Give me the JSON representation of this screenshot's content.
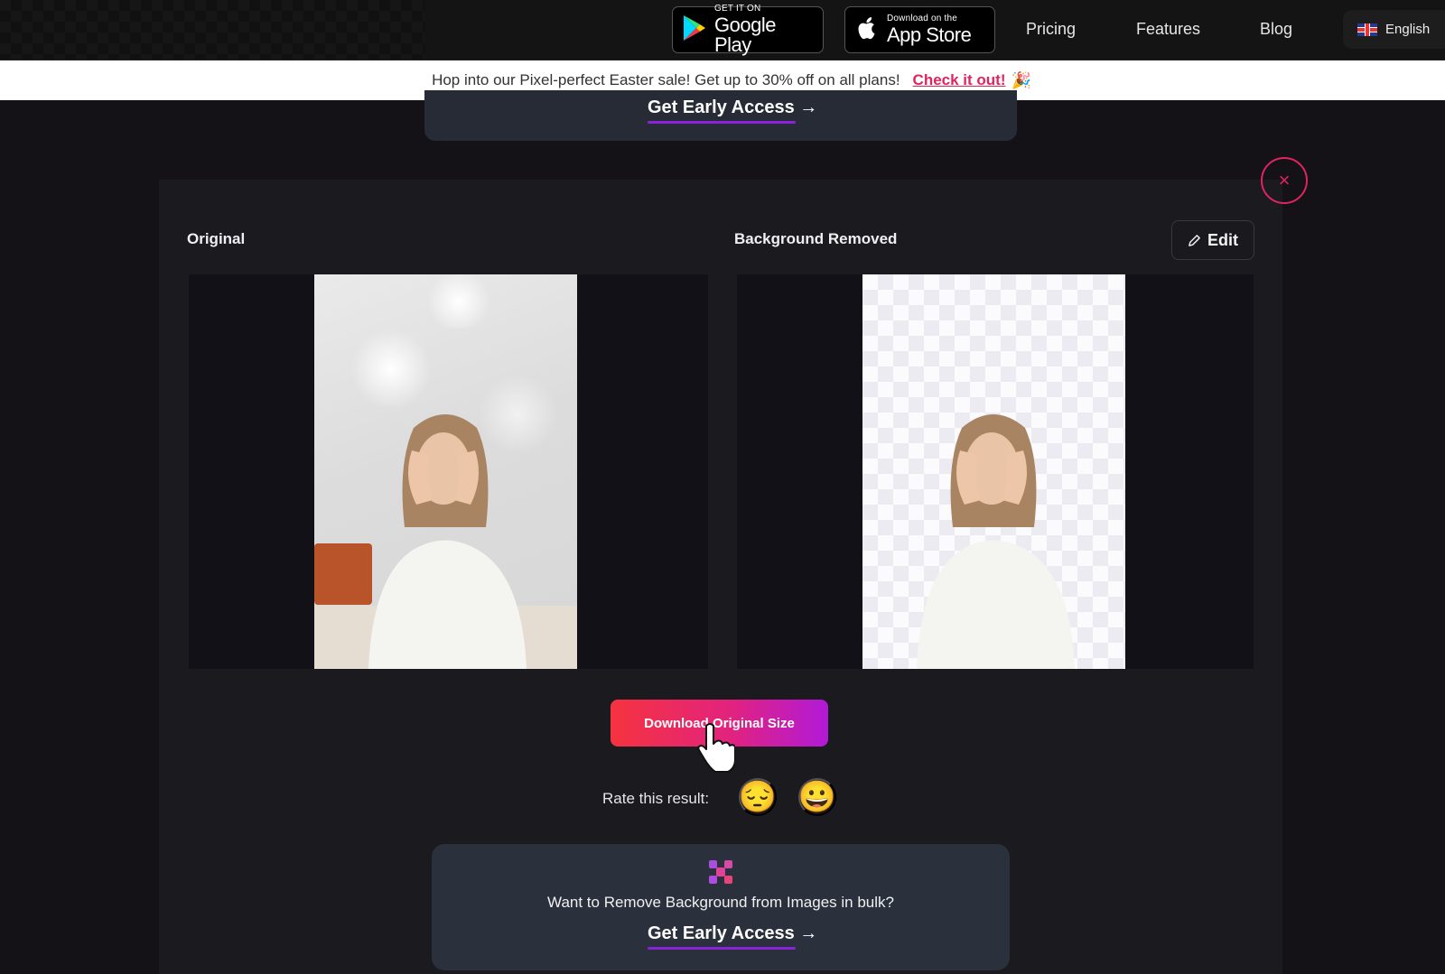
{
  "nav": {
    "google_play": {
      "small": "GET IT ON",
      "big": "Google Play"
    },
    "app_store": {
      "small": "Download on the",
      "big": "App Store"
    },
    "links": [
      "Pricing",
      "Features",
      "Blog"
    ],
    "language": {
      "label": "English",
      "flag": "uk-flag"
    }
  },
  "promo": {
    "text": "Hop into our Pixel-perfect Easter sale! Get up to 30% off on all plans!",
    "link_label": "Check it out!",
    "emoji": "🎉"
  },
  "top_cta": {
    "label": "Get Early Access",
    "arrow": "→"
  },
  "result": {
    "original_label": "Original",
    "removed_label": "Background Removed",
    "edit_label": "Edit",
    "close_icon": "×",
    "download_label": "Download Original Size",
    "rate_label": "Rate this result:",
    "rating_options": [
      {
        "name": "sad",
        "emoji": "😔"
      },
      {
        "name": "happy",
        "emoji": "😀"
      }
    ]
  },
  "bulk_cta": {
    "text": "Want to Remove Background from Images in bulk?",
    "label": "Get Early Access",
    "arrow": "→"
  },
  "colors": {
    "accent": "#e0245e",
    "button_gradient_start": "#f5333f",
    "button_gradient_end": "#b11ad8",
    "underline": "#8a22d8"
  }
}
